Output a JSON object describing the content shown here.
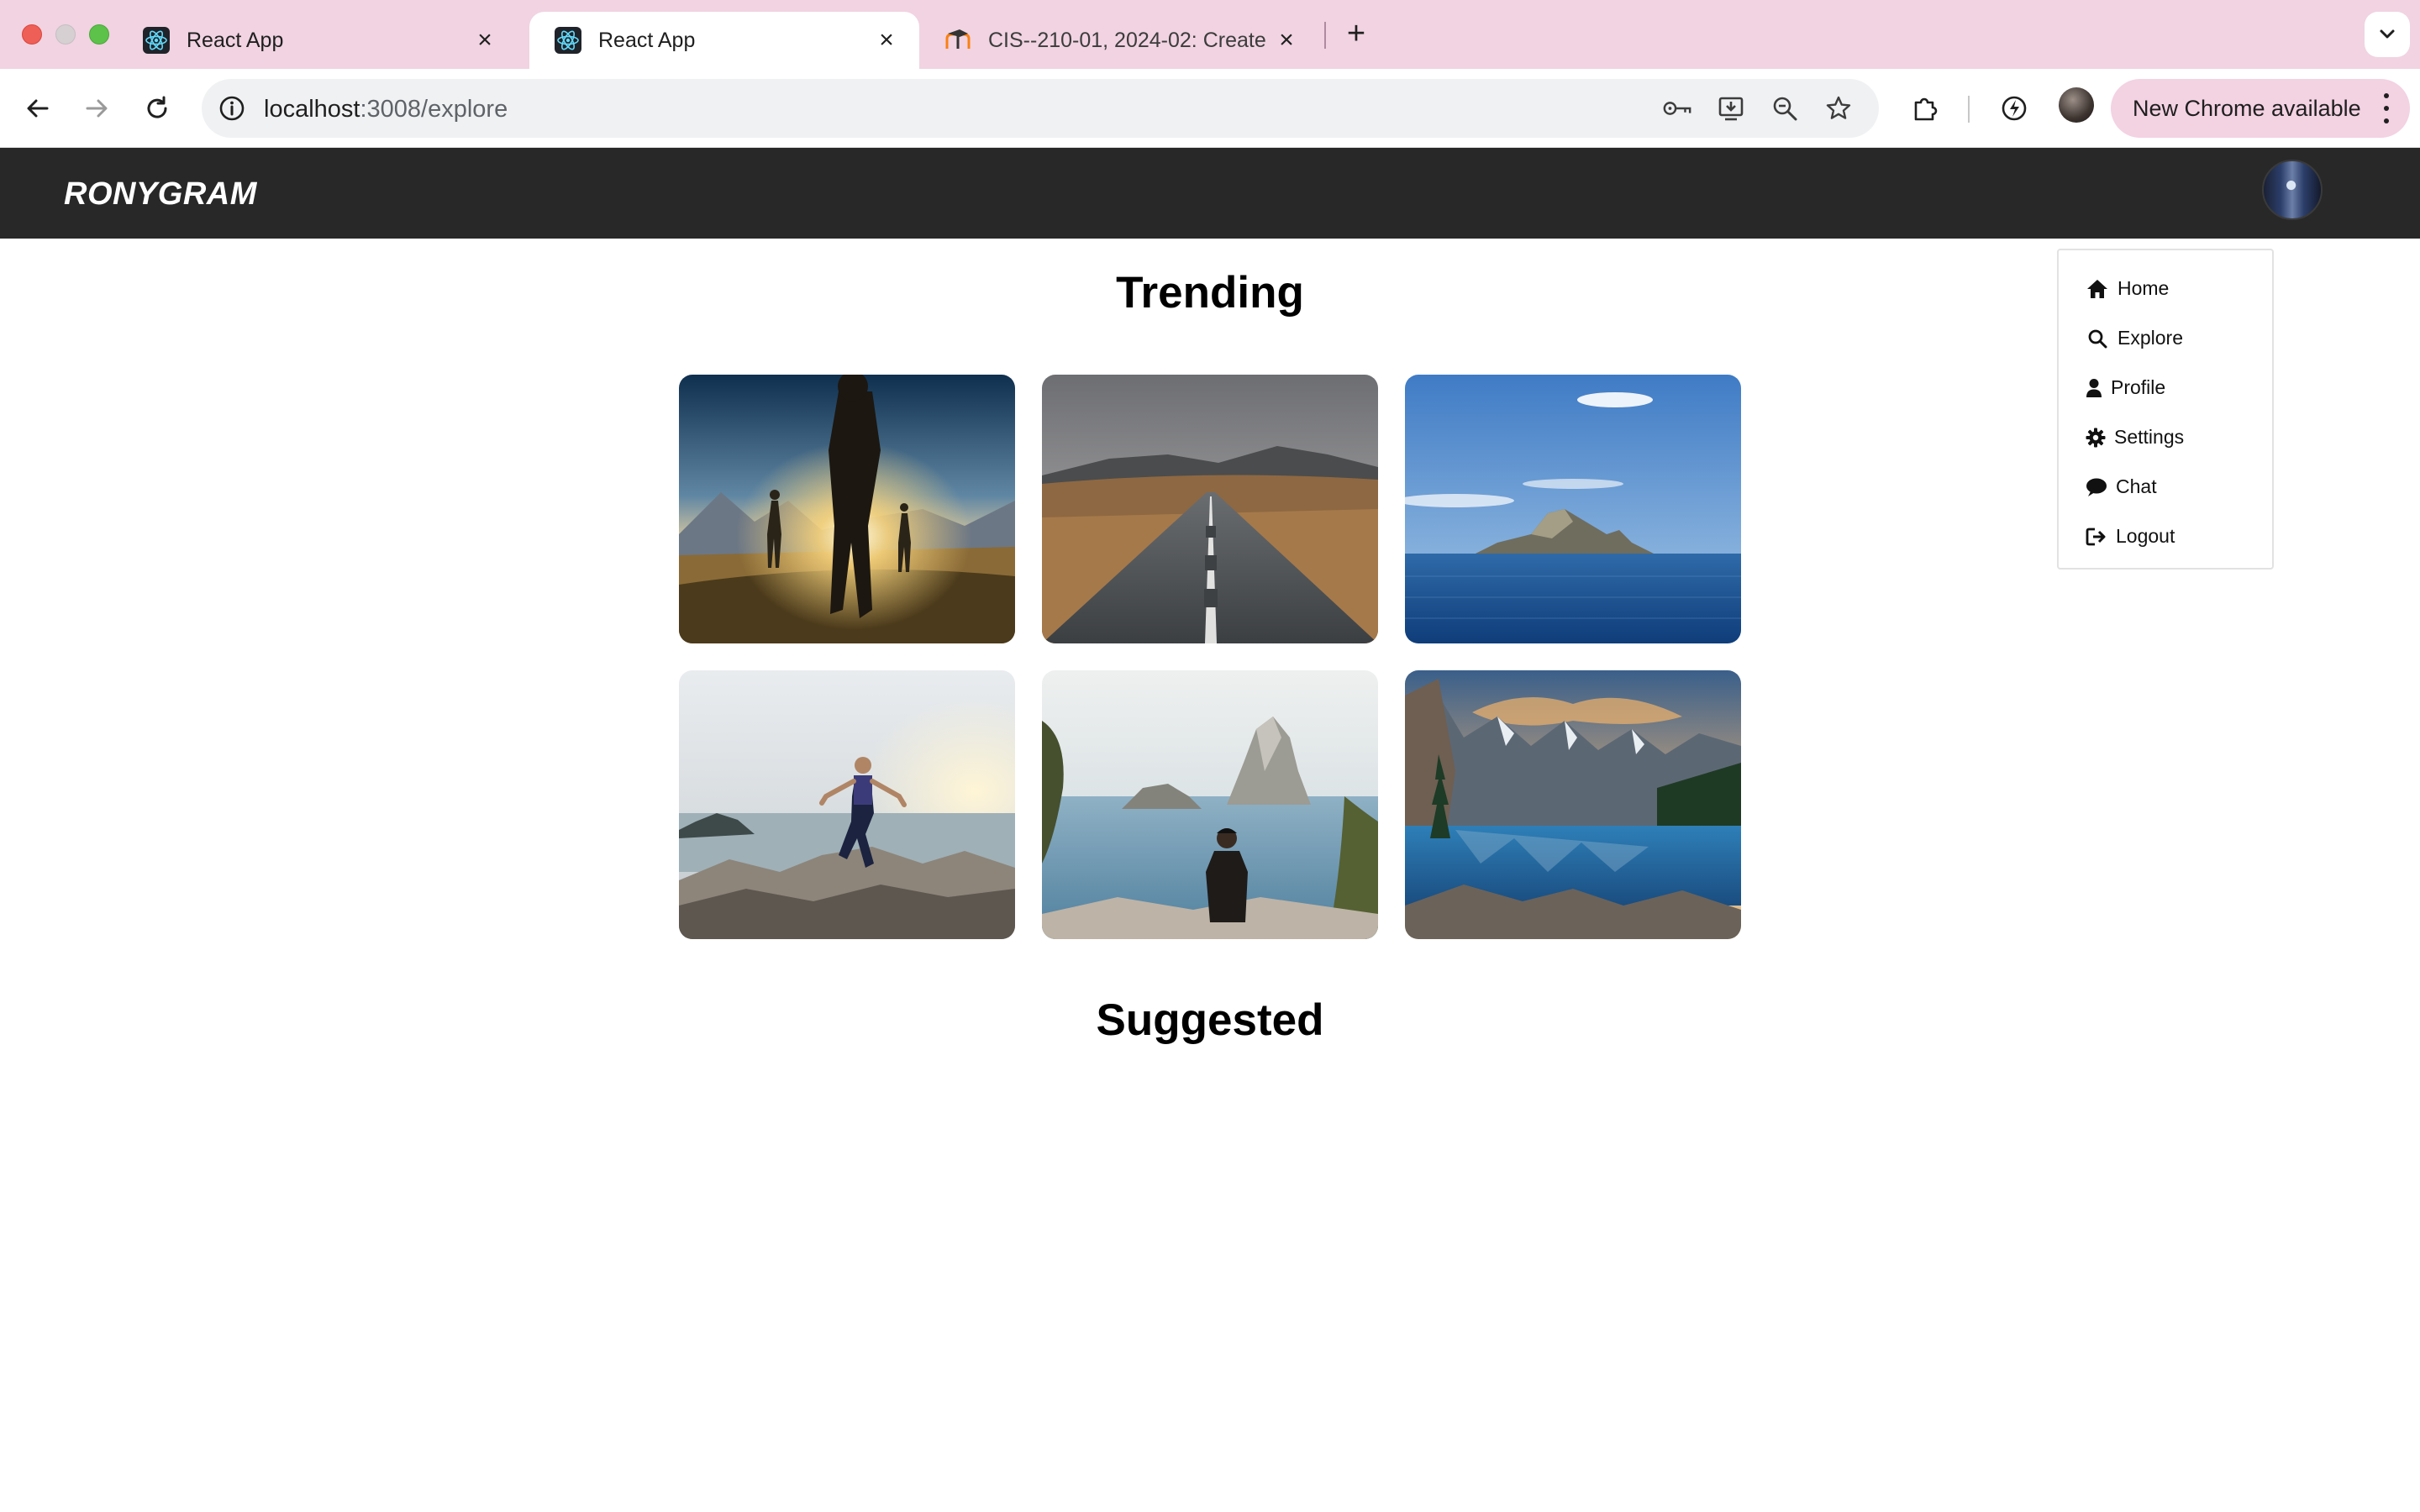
{
  "browser": {
    "tabs": [
      {
        "title": "React App",
        "favicon": "react-icon"
      },
      {
        "title": "React App",
        "favicon": "react-icon"
      },
      {
        "title": "CIS--210-01, 2024-02: Create",
        "favicon": "moodle-icon"
      }
    ],
    "url_host": "localhost",
    "url_path": ":3008/explore",
    "update_label": "New Chrome available"
  },
  "app": {
    "brand": "RONYGRAM",
    "menu": [
      {
        "label": "Home",
        "icon": "home-icon"
      },
      {
        "label": "Explore",
        "icon": "search-icon"
      },
      {
        "label": "Profile",
        "icon": "user-icon"
      },
      {
        "label": "Settings",
        "icon": "gear-icon"
      },
      {
        "label": "Chat",
        "icon": "chat-icon"
      },
      {
        "label": "Logout",
        "icon": "logout-icon"
      }
    ],
    "sections": {
      "trending": "Trending",
      "suggested": "Suggested"
    },
    "photos": [
      "hikers-sunset-photo",
      "desert-road-photo",
      "island-sea-photo",
      "climber-coast-photo",
      "man-watching-rock-island-photo",
      "mountain-lake-photo"
    ]
  }
}
